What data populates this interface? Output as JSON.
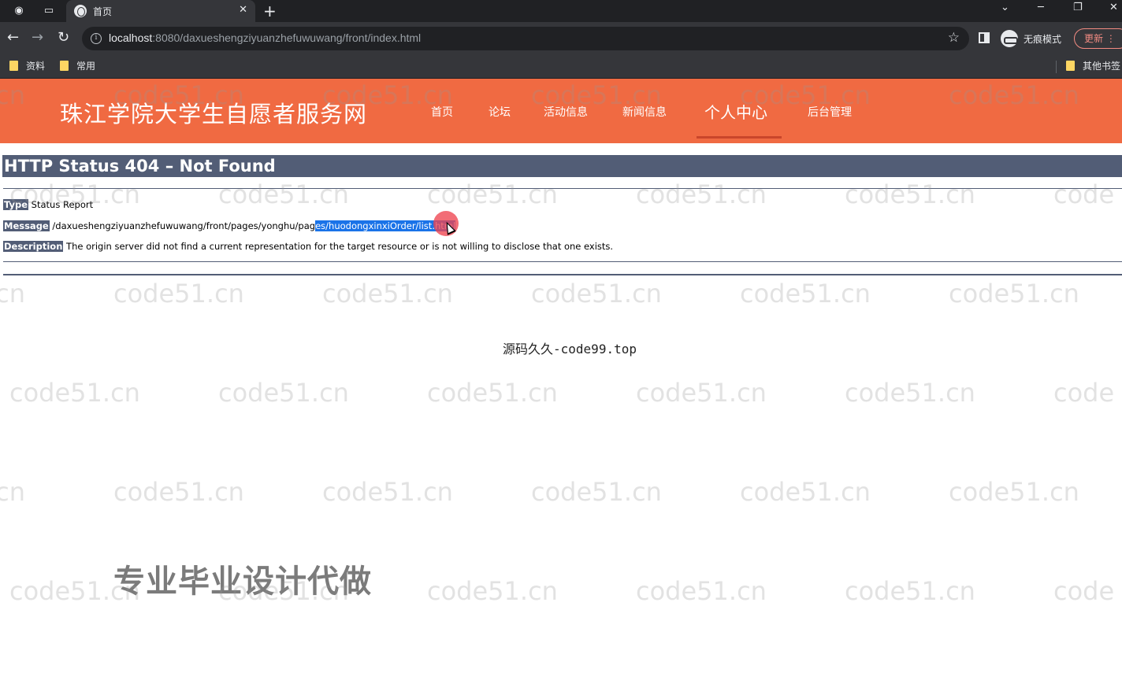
{
  "browser": {
    "tab_title": "首页",
    "url_host": "localhost",
    "url_rest": ":8080/daxueshengziyuanzhefuwuwang/front/index.html",
    "incognito_label": "无痕模式",
    "update_label": "更新",
    "bookmarks": [
      "资料",
      "常用"
    ],
    "other_bookmarks": "其他书签"
  },
  "site": {
    "title": "珠江学院大学生自愿者服务网",
    "nav": [
      "首页",
      "论坛",
      "活动信息",
      "新闻信息",
      "个人中心",
      "后台管理"
    ],
    "active_nav": "个人中心"
  },
  "error": {
    "title": "HTTP Status 404 – Not Found",
    "type_label": "Type",
    "type_value": "Status Report",
    "message_label": "Message",
    "message_unselected": "/daxueshengziyuanzhefuwuwang/front/pages/yonghu/pag",
    "message_selected": "es/huodongxinxiOrder/list.html",
    "description_label": "Description",
    "description_value": "The origin server did not find a current representation for the target resource or is not willing to disclose that one exists."
  },
  "overlay": {
    "source_credit": "源码久久-code99.top",
    "ad_text": "专业毕业设计代做",
    "watermark": "code51.cn"
  },
  "colors": {
    "header_bg": "#f06a42",
    "status_bar": "#525d76",
    "selection": "#1a73e8",
    "cursor_highlight": "#ee4450"
  }
}
